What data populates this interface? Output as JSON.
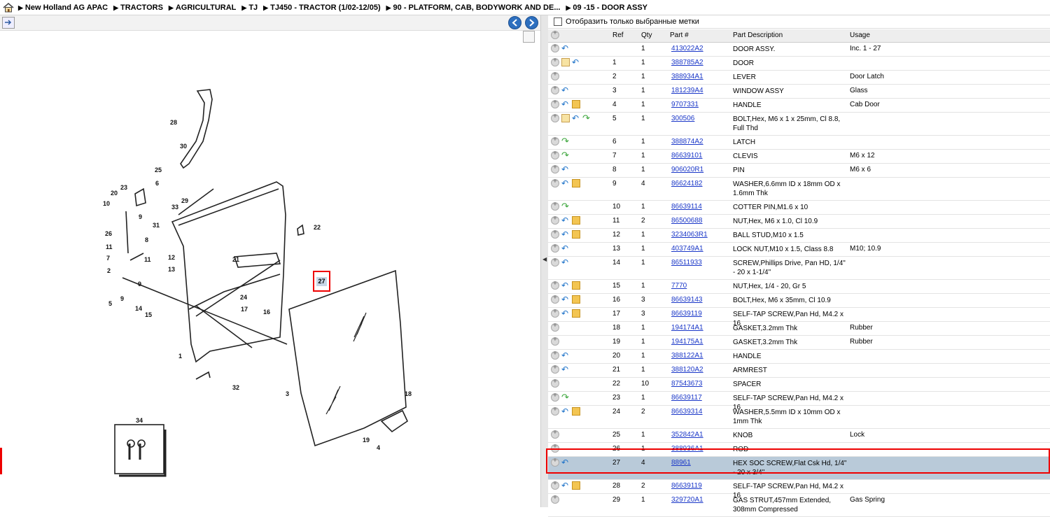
{
  "breadcrumb": [
    "New Holland AG APAC",
    "TRACTORS",
    "AGRICULTURAL",
    "TJ",
    "TJ450 - TRACTOR (1/02-12/05)",
    "90 - PLATFORM, CAB, BODYWORK AND DE...",
    "09 -15 - DOOR ASSY"
  ],
  "filter_label": "Отобразить только выбранные метки",
  "columns": [
    "Ref",
    "Qty",
    "Part #",
    "Part Description",
    "Usage"
  ],
  "rows": [
    {
      "icons": [
        "back"
      ],
      "ref": "",
      "qty": "1",
      "part": "413022A2",
      "desc": "DOOR ASSY.",
      "usage": "Inc. 1 - 27"
    },
    {
      "icons": [
        "note",
        "back"
      ],
      "ref": "1",
      "qty": "1",
      "part": "388785A2",
      "desc": "DOOR",
      "usage": ""
    },
    {
      "icons": [],
      "ref": "2",
      "qty": "1",
      "part": "388934A1",
      "desc": "LEVER",
      "usage": "Door Latch"
    },
    {
      "icons": [
        "back"
      ],
      "ref": "3",
      "qty": "1",
      "part": "181239A4",
      "desc": "WINDOW ASSY",
      "usage": "Glass"
    },
    {
      "icons": [
        "back",
        "box"
      ],
      "ref": "4",
      "qty": "1",
      "part": "9707331",
      "desc": "HANDLE",
      "usage": "Cab Door"
    },
    {
      "icons": [
        "note",
        "back",
        "fwd"
      ],
      "ref": "5",
      "qty": "1",
      "part": "300506",
      "desc": "BOLT,Hex, M6 x 1 x 25mm, Cl 8.8, Full Thd",
      "usage": ""
    },
    {
      "icons": [
        "fwd"
      ],
      "ref": "6",
      "qty": "1",
      "part": "388874A2",
      "desc": "LATCH",
      "usage": ""
    },
    {
      "icons": [
        "fwd"
      ],
      "ref": "7",
      "qty": "1",
      "part": "86639101",
      "desc": "CLEVIS",
      "usage": "M6 x 12"
    },
    {
      "icons": [
        "back"
      ],
      "ref": "8",
      "qty": "1",
      "part": "906020R1",
      "desc": "PIN",
      "usage": "M6 x 6"
    },
    {
      "icons": [
        "back",
        "box"
      ],
      "ref": "9",
      "qty": "4",
      "part": "86624182",
      "desc": "WASHER,6.6mm ID x 18mm OD x 1.6mm Thk",
      "usage": ""
    },
    {
      "icons": [
        "fwd"
      ],
      "ref": "10",
      "qty": "1",
      "part": "86639114",
      "desc": "COTTER PIN,M1.6 x 10",
      "usage": ""
    },
    {
      "icons": [
        "back",
        "box"
      ],
      "ref": "11",
      "qty": "2",
      "part": "86500688",
      "desc": "NUT,Hex, M6 x 1.0, Cl 10.9",
      "usage": ""
    },
    {
      "icons": [
        "back",
        "box"
      ],
      "ref": "12",
      "qty": "1",
      "part": "3234063R1",
      "desc": "BALL STUD,M10 x 1.5",
      "usage": ""
    },
    {
      "icons": [
        "back"
      ],
      "ref": "13",
      "qty": "1",
      "part": "403749A1",
      "desc": "LOCK NUT,M10 x 1.5, Class 8.8",
      "usage": "M10; 10.9"
    },
    {
      "icons": [
        "back"
      ],
      "ref": "14",
      "qty": "1",
      "part": "86511933",
      "desc": "SCREW,Phillips Drive, Pan HD, 1/4\" - 20 x 1-1/4\"",
      "usage": ""
    },
    {
      "icons": [
        "back",
        "box"
      ],
      "ref": "15",
      "qty": "1",
      "part": "7770",
      "desc": "NUT,Hex, 1/4 - 20, Gr 5",
      "usage": ""
    },
    {
      "icons": [
        "back",
        "box"
      ],
      "ref": "16",
      "qty": "3",
      "part": "86639143",
      "desc": "BOLT,Hex, M6 x 35mm, Cl 10.9",
      "usage": ""
    },
    {
      "icons": [
        "back",
        "box"
      ],
      "ref": "17",
      "qty": "3",
      "part": "86639119",
      "desc": "SELF-TAP SCREW,Pan Hd, M4.2 x 16",
      "usage": ""
    },
    {
      "icons": [],
      "ref": "18",
      "qty": "1",
      "part": "194174A1",
      "desc": "GASKET,3.2mm Thk",
      "usage": "Rubber"
    },
    {
      "icons": [],
      "ref": "19",
      "qty": "1",
      "part": "194175A1",
      "desc": "GASKET,3.2mm Thk",
      "usage": "Rubber"
    },
    {
      "icons": [
        "back"
      ],
      "ref": "20",
      "qty": "1",
      "part": "388122A1",
      "desc": "HANDLE",
      "usage": ""
    },
    {
      "icons": [
        "back"
      ],
      "ref": "21",
      "qty": "1",
      "part": "388120A2",
      "desc": "ARMREST",
      "usage": ""
    },
    {
      "icons": [],
      "ref": "22",
      "qty": "10",
      "part": "87543673",
      "desc": "SPACER",
      "usage": ""
    },
    {
      "icons": [
        "fwd"
      ],
      "ref": "23",
      "qty": "1",
      "part": "86639117",
      "desc": "SELF-TAP SCREW,Pan Hd, M4.2 x 16",
      "usage": ""
    },
    {
      "icons": [
        "back",
        "box"
      ],
      "ref": "24",
      "qty": "2",
      "part": "86639314",
      "desc": "WASHER,5.5mm ID x 10mm OD x 1mm Thk",
      "usage": ""
    },
    {
      "icons": [],
      "ref": "25",
      "qty": "1",
      "part": "352842A1",
      "desc": "KNOB",
      "usage": "Lock"
    },
    {
      "icons": [],
      "ref": "26",
      "qty": "1",
      "part": "388936A1",
      "desc": "ROD",
      "usage": ""
    },
    {
      "icons": [
        "back"
      ],
      "ref": "27",
      "qty": "4",
      "part": "88961",
      "desc": "HEX SOC SCREW,Flat Csk Hd, 1/4\" - 20 x 3/4\"",
      "usage": "",
      "selected": true
    },
    {
      "icons": [
        "back",
        "box"
      ],
      "ref": "28",
      "qty": "2",
      "part": "86639119",
      "desc": "SELF-TAP SCREW,Pan Hd, M4.2 x 16",
      "usage": ""
    },
    {
      "icons": [],
      "ref": "29",
      "qty": "1",
      "part": "329720A1",
      "desc": "GAS STRUT,457mm Extended, 308mm Compressed",
      "usage": "Gas Spring"
    }
  ],
  "diagram_labels": [
    "28",
    "30",
    "25",
    "6",
    "23",
    "20",
    "10",
    "9",
    "31",
    "29",
    "33",
    "26",
    "11",
    "8",
    "7",
    "12",
    "13",
    "2",
    "9",
    "5",
    "9",
    "14",
    "15",
    "21",
    "22",
    "24",
    "17",
    "16",
    "1",
    "32",
    "3",
    "34",
    "18",
    "19",
    "4",
    "11"
  ],
  "callout_label": "27"
}
